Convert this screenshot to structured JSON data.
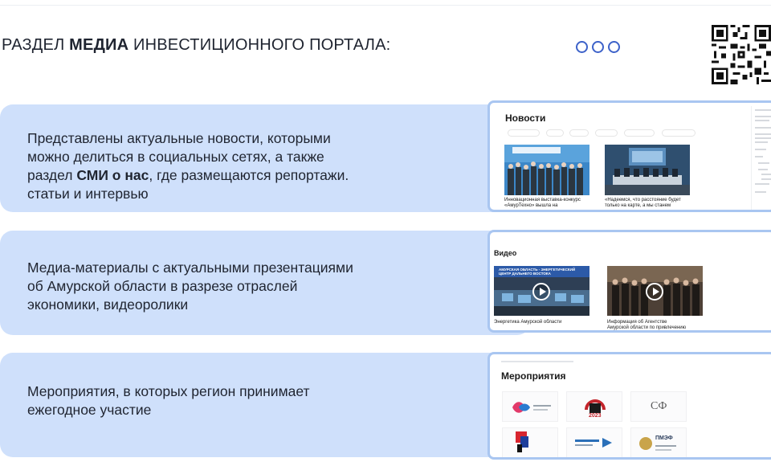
{
  "header": {
    "title_prefix": "РАЗДЕЛ ",
    "title_bold": "МЕДИА",
    "title_suffix": " ИНВЕСТИЦИОННОГО ПОРТАЛА:"
  },
  "cards": [
    {
      "line1": "Представлены актуальные новости, которыми",
      "line2": "можно делиться в социальных сетях, а также",
      "line3_pre": "раздел ",
      "line3_bold": "СМИ о нас",
      "line3_post": ", где размещаются репортажи.",
      "line4": "статьи и интервью"
    },
    {
      "line1": "Медиа-материалы с актуальными презентациями",
      "line2": "об Амурской области в разрезе отраслей",
      "line3": "экономики, видеоролики"
    },
    {
      "line1": "Мероприятия, в которых регион принимает",
      "line2": "ежегодное участие"
    }
  ],
  "news_shot": {
    "title": "Новости",
    "item1_caption_1": "Инновационная выставка-конкурс",
    "item1_caption_2": "«АмурТехно» вышла на",
    "item2_caption_1": "«Надеемся, что расстояние будет",
    "item2_caption_2": "только на карте, а мы станем"
  },
  "video_shot": {
    "title": "Видео",
    "item1_caption": "Энергетика Амурской области",
    "item2_caption_1": "Информация об Агентстве",
    "item2_caption_2": "Амурской области по привлечению",
    "overlay_1": "АМУРСКАЯ ОБЛАСТЬ - ЭНЕРГЕТИЧЕСКИЙ",
    "overlay_2": "ЦЕНТР ДАЛЬНЕГО ВОСТОКА"
  },
  "events_shot": {
    "title": "Мероприятия",
    "logo_sf": "СФ",
    "logo_year": "2023",
    "logo_pmef": "ПМЭФ"
  },
  "colors": {
    "card_bg": "#cfe0fb",
    "accent": "#3d62c9",
    "shot_border": "#a9c6f1"
  }
}
